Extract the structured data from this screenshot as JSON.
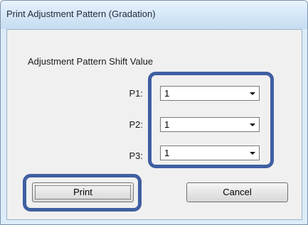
{
  "window": {
    "title": "Print Adjustment Pattern (Gradation)"
  },
  "group": {
    "label": "Adjustment Pattern Shift Value"
  },
  "rows": [
    {
      "label": "P1:",
      "value": "1"
    },
    {
      "label": "P2:",
      "value": "1"
    },
    {
      "label": "P3:",
      "value": "1"
    }
  ],
  "buttons": {
    "print_label": "Print",
    "cancel_label": "Cancel"
  },
  "colors": {
    "highlight": "#3f5fa2",
    "titlebar": "#d7e8f8",
    "dialog_bg": "#f0f0f0"
  },
  "icons": {
    "combo_arrow": "chevron-down-icon"
  }
}
